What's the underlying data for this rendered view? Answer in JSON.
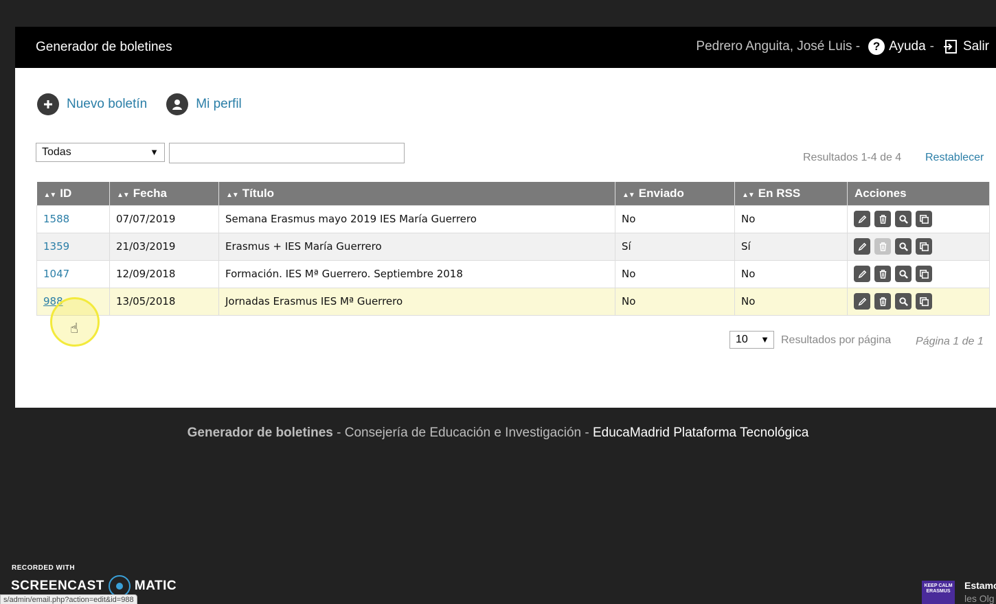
{
  "header": {
    "brand": "Generador de boletines",
    "user": "Pedrero Anguita, José Luis -",
    "help_label": "Ayuda",
    "help_sep": "-",
    "exit_label": "Salir"
  },
  "actions": {
    "new_label": "Nuevo boletín",
    "profile_label": "Mi perfil"
  },
  "filter": {
    "selected": "Todas",
    "search_value": ""
  },
  "results_text": "Resultados 1-4 de 4",
  "reset_label": "Restablecer",
  "table": {
    "columns": [
      "ID",
      "Fecha",
      "Título",
      "Enviado",
      "En RSS",
      "Acciones"
    ],
    "rows": [
      {
        "id": "1588",
        "fecha": "07/07/2019",
        "titulo": "Semana Erasmus mayo 2019 IES María Guerrero",
        "enviado": "No",
        "rss": "No"
      },
      {
        "id": "1359",
        "fecha": "21/03/2019",
        "titulo": "Erasmus + IES María Guerrero",
        "enviado": "Sí",
        "rss": "Sí"
      },
      {
        "id": "1047",
        "fecha": "12/09/2018",
        "titulo": "Formación. IES Mª Guerrero. Septiembre 2018",
        "enviado": "No",
        "rss": "No"
      },
      {
        "id": "988",
        "fecha": "13/05/2018",
        "titulo": "Jornadas Erasmus IES Mª Guerrero",
        "enviado": "No",
        "rss": "No"
      }
    ]
  },
  "pagination": {
    "per_page": "10",
    "per_page_label": "Resultados por página",
    "page_info": "Página 1 de 1"
  },
  "footer": {
    "part1": "Generador de boletines",
    "sep1": " - ",
    "part2": "Consejería de Educación e Investigación",
    "sep2": " - ",
    "part3": "EducaMadrid Plataforma Tecnológica"
  },
  "overlay": {
    "recorded_with": "RECORDED WITH",
    "screencast": "SCREENCAST",
    "matic": "MATIC",
    "status_url": "s/admin/email.php?action=edit&id=988",
    "keep_calm": "KEEP CALM ERASMUS",
    "notif_title": "Estamo",
    "notif_sub": "les Olg"
  },
  "icons": {
    "action_buttons": [
      "pencil-icon",
      "trash-icon",
      "magnifier-icon",
      "copy-icon"
    ]
  },
  "colors": {
    "link": "#2a7ea7",
    "header_bg": "#000000",
    "table_header": "#7a7a7a",
    "highlight_row": "#fbf9d6"
  }
}
